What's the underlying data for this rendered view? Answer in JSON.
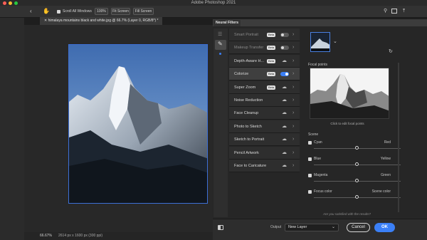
{
  "window": {
    "title": "Adobe Photoshop 2021"
  },
  "options_bar": {
    "scroll_all_windows_label": "Scroll All Windows",
    "zoom_value": "100%",
    "fit_screen_label": "Fit Screen",
    "fill_screen_label": "Fill Screen"
  },
  "document": {
    "tab_label": "himalaya mountains black and white.jpg @ 66.7% (Layer 0, RGB/8*) *",
    "status_zoom": "66.67%",
    "status_info": "2614 px x 1600 px (300 ppi)"
  },
  "panel": {
    "tab_label": "Neural Filters",
    "filters": [
      {
        "label": "Smart Portrait",
        "badge": "Beta",
        "control": "toggle",
        "state": "off",
        "dim": true
      },
      {
        "label": "Makeup Transfer",
        "badge": "Beta",
        "control": "toggle",
        "state": "off",
        "dim": true
      },
      {
        "label": "Depth-Aware H...",
        "badge": "Beta",
        "control": "cloud",
        "state": "",
        "dim": false
      },
      {
        "label": "Colorize",
        "badge": "Beta",
        "control": "toggle",
        "state": "on",
        "dim": false
      },
      {
        "label": "Super Zoom",
        "badge": "Beta",
        "control": "cloud",
        "state": "",
        "dim": false
      },
      {
        "label": "Noise Reduction",
        "badge": "",
        "control": "cloud",
        "state": "",
        "dim": false
      },
      {
        "label": "Face Cleanup",
        "badge": "",
        "control": "cloud",
        "state": "",
        "dim": false
      },
      {
        "label": "Photo to Sketch",
        "badge": "",
        "control": "cloud",
        "state": "",
        "dim": false
      },
      {
        "label": "Sketch to Portrait",
        "badge": "",
        "control": "cloud",
        "state": "",
        "dim": false
      },
      {
        "label": "Pencil Artwork",
        "badge": "",
        "control": "cloud",
        "state": "",
        "dim": false
      },
      {
        "label": "Face to Caricature",
        "badge": "",
        "control": "cloud",
        "state": "",
        "dim": false
      }
    ],
    "focal_points_label": "Focal points",
    "focal_hint": "Click to edit focal points",
    "scene_label": "Scene",
    "sliders": [
      {
        "left": "Cyan",
        "right": "Red",
        "value": 0.5
      },
      {
        "left": "Blue",
        "right": "Yellow",
        "value": 0.5
      },
      {
        "left": "Magenta",
        "right": "Green",
        "value": 0.5
      },
      {
        "left": "Focus color",
        "right": "Scene color",
        "value": 0.5
      }
    ],
    "feedback": "Are you satisfied with the results?",
    "output_label": "Output",
    "output_value": "New Layer",
    "cancel_label": "Cancel",
    "ok_label": "OK"
  },
  "colors": {
    "accent": "#3b80f7",
    "panel_bg": "#262626",
    "selected_row": "#3f3f3f"
  },
  "icons": [
    "home-icon",
    "move-tool-icon",
    "hand-tool-icon",
    "zoom-tool-icon",
    "eyedropper-icon",
    "brush-icon",
    "search-icon",
    "workspace-icon",
    "share-icon",
    "toggle-view-icon",
    "cloud-download-icon",
    "chevron-right-icon",
    "chevron-down-icon",
    "reset-icon"
  ]
}
